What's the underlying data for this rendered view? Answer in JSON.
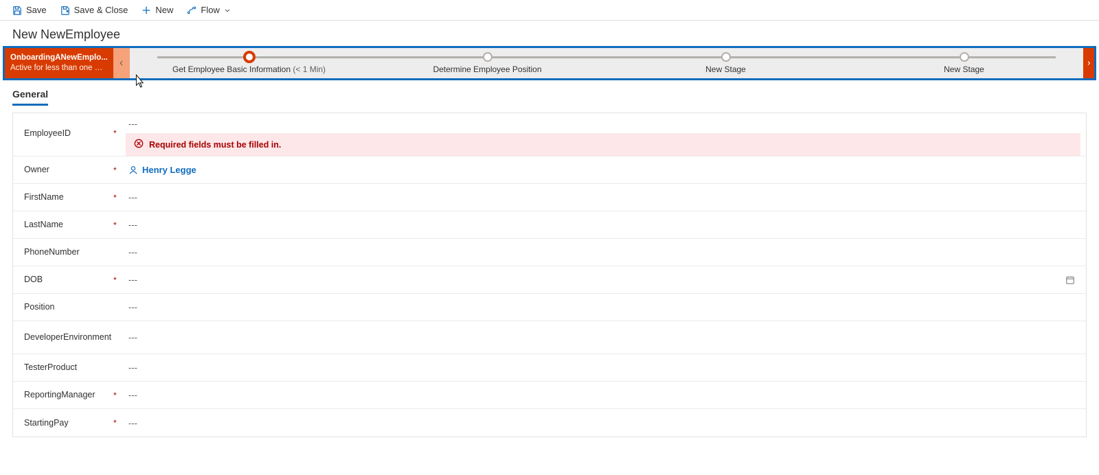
{
  "commands": {
    "save": "Save",
    "save_close": "Save & Close",
    "new": "New",
    "flow": "Flow"
  },
  "page_title": "New NewEmployee",
  "bpf": {
    "process_name": "OnboardingANewEmplo...",
    "status": "Active for less than one mi...",
    "stages": [
      {
        "label": "Get Employee Basic Information",
        "duration": "(< 1 Min)",
        "active": true
      },
      {
        "label": "Determine Employee Position",
        "duration": "",
        "active": false
      },
      {
        "label": "New Stage",
        "duration": "",
        "active": false
      },
      {
        "label": "New Stage",
        "duration": "",
        "active": false
      }
    ]
  },
  "tabs": {
    "general": "General"
  },
  "form": {
    "empty": "---",
    "error": "Required fields must be filled in.",
    "owner_name": "Henry Legge",
    "fields": {
      "employee_id": "EmployeeID",
      "owner": "Owner",
      "first_name": "FirstName",
      "last_name": "LastName",
      "phone_number": "PhoneNumber",
      "dob": "DOB",
      "position": "Position",
      "dev_env": "DeveloperEnvironment",
      "tester_product": "TesterProduct",
      "reporting_manager": "ReportingManager",
      "starting_pay": "StartingPay"
    }
  }
}
